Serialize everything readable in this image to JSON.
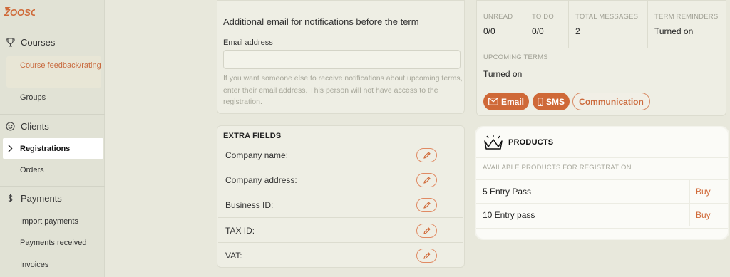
{
  "app": {
    "logo_text": "ZOOSO"
  },
  "sidebar": {
    "courses": {
      "label": "Courses",
      "items": [
        "Course feedback/rating",
        "Groups"
      ]
    },
    "clients": {
      "label": "Clients",
      "items": [
        "Registrations",
        "Orders"
      ]
    },
    "payments": {
      "label": "Payments",
      "items": [
        "Import payments",
        "Payments received",
        "Invoices"
      ]
    }
  },
  "email_card": {
    "title": "Additional email for notifications before the term",
    "field_label": "Email address",
    "value": "",
    "help": "If you want someone else to receive notifications about upcoming terms, enter their email address. This person will not have access to the registration."
  },
  "extra_fields": {
    "title": "EXTRA FIELDS",
    "fields": [
      "Company name:",
      "Company address:",
      "Business ID:",
      "TAX ID:",
      "VAT:"
    ]
  },
  "stats": {
    "cells": [
      {
        "label": "UNREAD",
        "value": "0/0"
      },
      {
        "label": "TO DO",
        "value": "0/0"
      },
      {
        "label": "TOTAL MESSAGES",
        "value": "2"
      },
      {
        "label": "TERM REMINDERS",
        "value": "Turned on"
      }
    ],
    "upcoming_label": "UPCOMING TERMS",
    "upcoming_value": "Turned on",
    "buttons": {
      "email": "Email",
      "sms": "SMS",
      "communication": "Communication"
    }
  },
  "products": {
    "title": "PRODUCTS",
    "subtitle": "AVAILABLE PRODUCTS FOR REGISTRATION",
    "items": [
      {
        "name": "5 Entry Pass",
        "action": "Buy"
      },
      {
        "name": "10 Entry pass",
        "action": "Buy"
      }
    ]
  },
  "colors": {
    "accent": "#cf6938",
    "accent_text": "#c86a3e",
    "background": "#e8e8dc"
  }
}
